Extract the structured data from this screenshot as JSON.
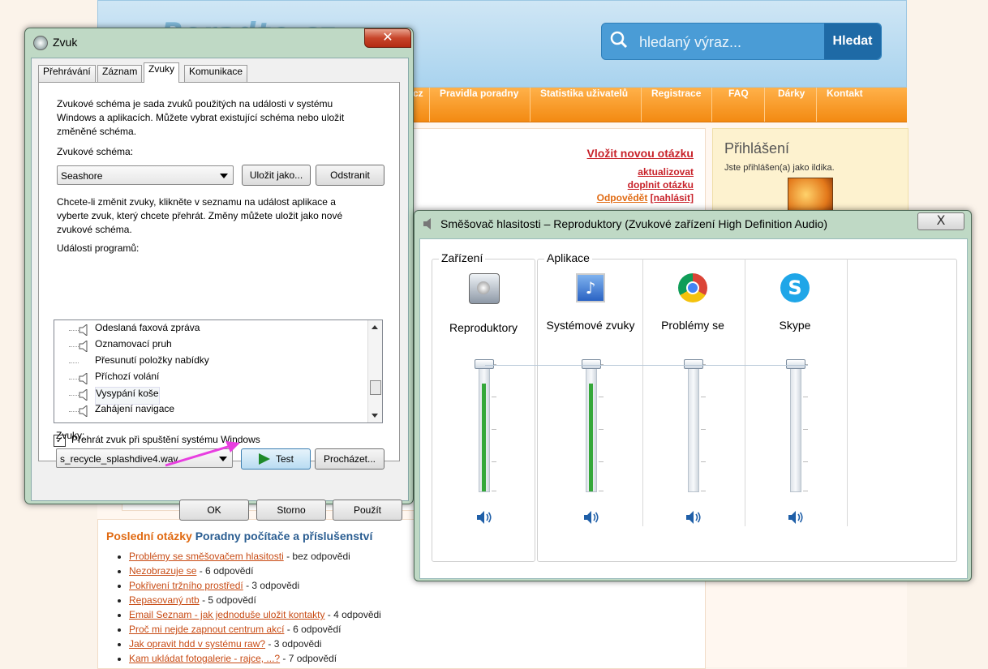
{
  "site": {
    "logo": "Poradte.cz",
    "search": {
      "placeholder": "hledaný výraz...",
      "button": "Hledat"
    },
    "nav": [
      "cz",
      "Pravidla poradny",
      "Statistika uživatelů",
      "Registrace",
      "FAQ",
      "Dárky",
      "Kontakt"
    ],
    "main": {
      "new_question": "Vložit novou otázku",
      "refresh": "aktualizovat",
      "add_question": "doplnit otázku",
      "answer": "Odpovědět",
      "report": "[nahlásit]"
    },
    "login": {
      "title": "Přihlášení",
      "text": "Jste přihlášen(a) jako ildika."
    },
    "recent": {
      "title": "Poslední otázky",
      "category": "Poradny počítače a příslušenství",
      "items": [
        {
          "link": "Problémy se směšovačem hlasitosti",
          "suffix": " - bez odpovědi"
        },
        {
          "link": "Nezobrazuje se",
          "suffix": " - 6 odpovědí"
        },
        {
          "link": "Pokřivení tržního prostředí",
          "suffix": " - 3 odpovědi"
        },
        {
          "link": "Repasovaný ntb",
          "suffix": " - 5 odpovědí"
        },
        {
          "link": "Email Seznam - jak jednoduše uložit kontakty",
          "suffix": " - 4 odpovědi"
        },
        {
          "link": "Proč mi nejde zapnout centrum akcí",
          "suffix": " - 6 odpovědí"
        },
        {
          "link": "Jak opravit hdd v systému raw?",
          "suffix": " - 3 odpovědi"
        },
        {
          "link": "Kam ukládat fotogalerie - rajce, ...?",
          "suffix": " - 7 odpovědí"
        }
      ]
    }
  },
  "zvuk": {
    "title": "Zvuk",
    "tabs": [
      "Přehrávání",
      "Záznam",
      "Zvuky",
      "Komunikace"
    ],
    "active_tab": "Zvuky",
    "intro_lines": [
      "Zvukové schéma je sada zvuků použitých na události v systému",
      "Windows a aplikacích. Můžete vybrat existující schéma nebo uložit",
      "změněné schéma."
    ],
    "scheme_label": "Zvukové schéma:",
    "scheme_value": "Seashore",
    "save_as": "Uložit jako...",
    "remove": "Odstranit",
    "change_lines": [
      "Chcete-li změnit zvuky, klikněte v seznamu na událost aplikace a",
      "vyberte zvuk, který chcete přehrát. Změny můžete uložit jako nové",
      "zvukové schéma."
    ],
    "events_label": "Události programů:",
    "events": [
      {
        "label": "Odeslaná faxová zpráva",
        "has_sound": true
      },
      {
        "label": "Oznamovací pruh",
        "has_sound": true
      },
      {
        "label": "Přesunutí položky nabídky",
        "has_sound": false
      },
      {
        "label": "Příchozí volání",
        "has_sound": true
      },
      {
        "label": "Vysypání koše",
        "has_sound": true
      },
      {
        "label": "Zahájení navigace",
        "has_sound": true
      }
    ],
    "selected_event": "Vysypání koše",
    "startup_checkbox": {
      "label": "Přehrát zvuk při spuštění systému Windows",
      "checked": true
    },
    "sounds_label": "Zvuky:",
    "sound_value": "s_recycle_splashdive4.wav",
    "test": "Test",
    "browse": "Procházet...",
    "ok": "OK",
    "cancel": "Storno",
    "apply": "Použít",
    "annotation_color": "#e83ee0"
  },
  "mixer": {
    "title": "Směšovač hlasitosti – Reproduktory (Zvukové zařízení High Definition Audio)",
    "close": "X",
    "device_group": "Zařízení",
    "apps_group": "Aplikace",
    "channels": [
      {
        "name": "Reproduktory",
        "icon": "speaker-device-icon",
        "level": 0.84
      },
      {
        "name": "Systémové zvuky",
        "icon": "system-sounds-icon",
        "level": 0.84
      },
      {
        "name": "Problémy se",
        "icon": "chrome-icon",
        "level": 0
      },
      {
        "name": "Skype",
        "icon": "skype-icon",
        "level": 0
      }
    ],
    "accent_green": "#35a83a"
  }
}
